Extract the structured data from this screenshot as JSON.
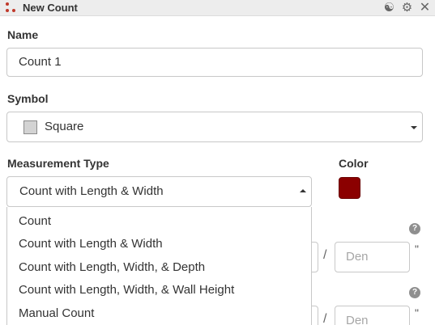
{
  "window": {
    "title": "New Count",
    "brand_color": "#c0392b"
  },
  "toolbar": {
    "icons": [
      "group-icon",
      "gear-icon",
      "close-icon"
    ]
  },
  "name": {
    "label": "Name",
    "value": "Count 1"
  },
  "symbol": {
    "label": "Symbol",
    "value": "Square",
    "swatch_color": "#d3d3d3"
  },
  "measurement_type": {
    "label": "Measurement Type",
    "value": "Count with Length & Width",
    "options": [
      "Count",
      "Count with Length & Width",
      "Count with Length, Width, & Depth",
      "Count with Length, Width, & Wall Height",
      "Manual Count"
    ]
  },
  "color": {
    "label": "Color",
    "value": "#8b0000"
  },
  "help": {
    "glyph": "?"
  },
  "fraction": {
    "separator": "/",
    "den_placeholder": "Den",
    "unit": "\""
  }
}
